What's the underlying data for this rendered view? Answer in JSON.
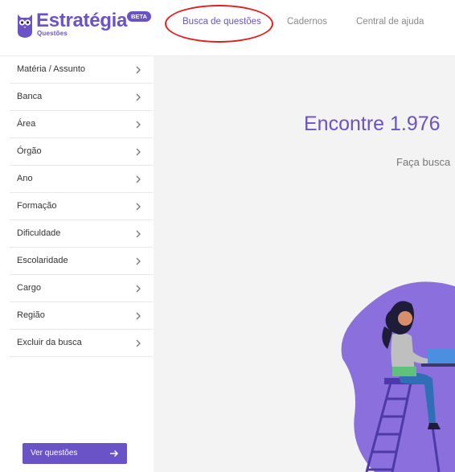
{
  "header": {
    "brand": "Estratégia",
    "brand_sub": "Questões",
    "beta": "BETA",
    "nav": [
      {
        "label": "Busca de questões",
        "active": true
      },
      {
        "label": "Cadernos",
        "active": false
      },
      {
        "label": "Central de ajuda",
        "active": false
      }
    ]
  },
  "sidebar": {
    "filters": [
      {
        "label": "Matéria / Assunto"
      },
      {
        "label": "Banca"
      },
      {
        "label": "Área"
      },
      {
        "label": "Órgão"
      },
      {
        "label": "Ano"
      },
      {
        "label": "Formação"
      },
      {
        "label": "Dificuldade"
      },
      {
        "label": "Escolaridade"
      },
      {
        "label": "Cargo"
      },
      {
        "label": "Região"
      },
      {
        "label": "Excluir da busca"
      }
    ],
    "cta_label": "Ver questões"
  },
  "main": {
    "headline": "Encontre 1.976",
    "subline": "Faça busca"
  },
  "colors": {
    "accent": "#6a52c7",
    "highlight_ellipse": "#e02020",
    "background": "#f3f3f3"
  },
  "icons": [
    "owl-logo-icon",
    "chevron-right-icon",
    "arrow-right-icon"
  ]
}
